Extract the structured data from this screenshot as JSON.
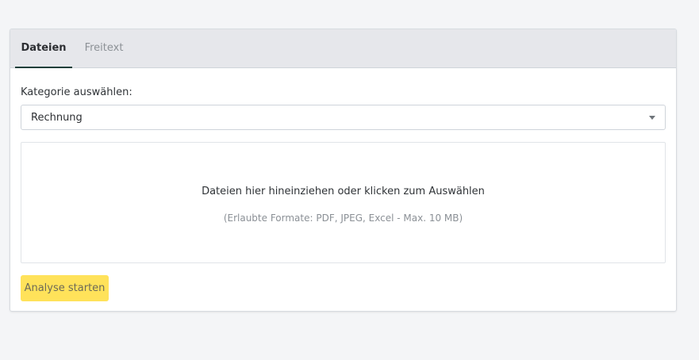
{
  "tabs": [
    {
      "label": "Dateien",
      "active": true
    },
    {
      "label": "Freitext",
      "active": false
    }
  ],
  "category": {
    "label": "Kategorie auswählen:",
    "selected_value": "Rechnung",
    "caret_icon": "chevron-down-icon"
  },
  "dropzone": {
    "primary_text": "Dateien hier hineinziehen oder klicken zum Auswählen",
    "secondary_text": "(Erlaubte Formate: PDF, JPEG, Excel - Max. 10 MB)"
  },
  "actions": {
    "start_label": "Analyse starten"
  },
  "colors": {
    "page_bg": "#f4f5f7",
    "tabbar_bg": "#e6e7eb",
    "active_tab_underline": "#173f3a",
    "button_bg": "#ffe25a"
  }
}
